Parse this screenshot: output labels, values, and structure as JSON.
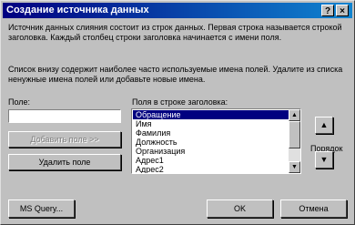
{
  "window": {
    "title": "Создание источника данных",
    "help_glyph": "?",
    "close_glyph": "×"
  },
  "info": {
    "paragraph1": "Источник данных слияния состоит из строк данных. Первая строка называется строкой заголовка. Каждый столбец строки заголовка начинается с имени поля.",
    "paragraph2": "Список внизу содержит наиболее часто используемые имена полей. Удалите из списка ненужные имена полей или добавьте новые имена."
  },
  "field": {
    "label": "Поле:",
    "value": ""
  },
  "buttons": {
    "add_field": "Добавить поле >>",
    "delete_field": "Удалить поле",
    "ms_query": "MS Query...",
    "ok": "OK",
    "cancel": "Отмена"
  },
  "header_list": {
    "label": "Поля в строке заголовка:",
    "items": [
      "Обращение",
      "Имя",
      "Фамилия",
      "Должность",
      "Организация",
      "Адрес1",
      "Адрес2"
    ],
    "selected_index": 0
  },
  "order": {
    "label": "Порядок",
    "up_glyph": "▲",
    "down_glyph": "▼"
  },
  "scroll": {
    "up_glyph": "▲",
    "down_glyph": "▼"
  }
}
